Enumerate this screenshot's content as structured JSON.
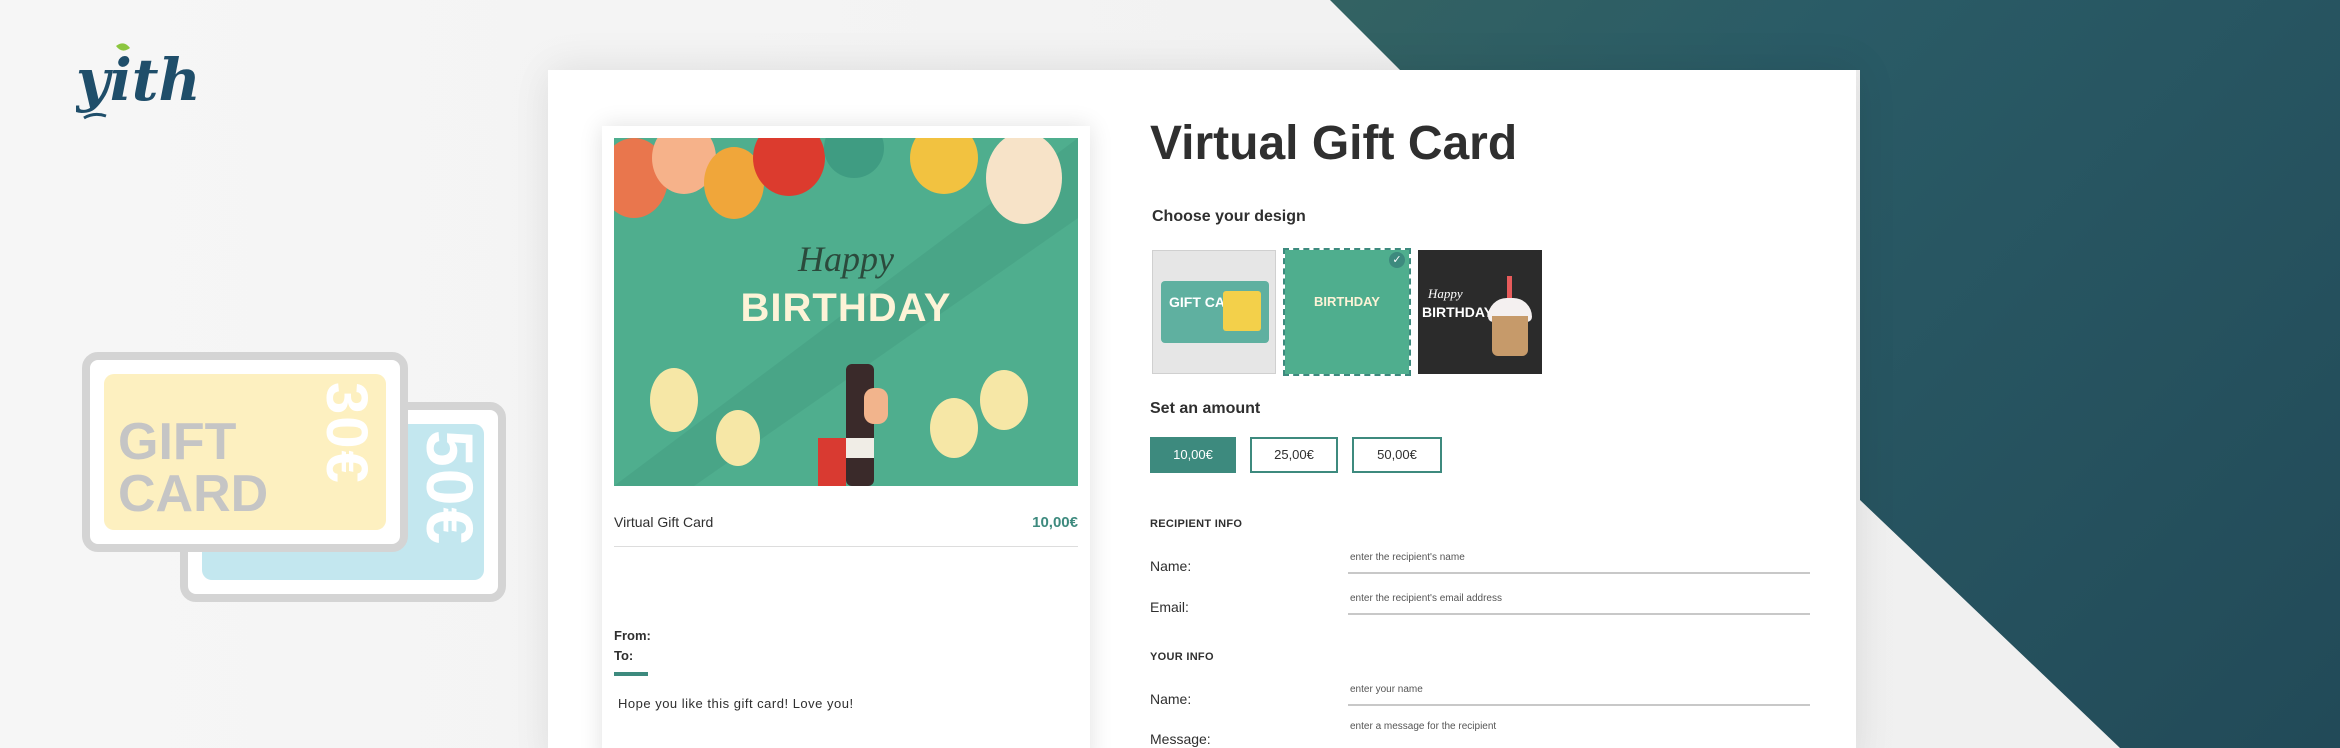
{
  "brand": {
    "logo_text": "yith"
  },
  "gift_card_icon": {
    "front_text": "GIFT\nCARD",
    "front_value": "30€",
    "back_value": "50€"
  },
  "preview": {
    "image_happy": "Happy",
    "image_birthday": "BIRTHDAY",
    "product_title": "Virtual Gift Card",
    "price": "10,00€",
    "from_label": "From:",
    "to_label": "To:",
    "message": "Hope you like this gift card! Love you!"
  },
  "form": {
    "title": "Virtual Gift Card",
    "choose_design_label": "Choose your design",
    "designs": [
      {
        "name": "gift-card-design",
        "text": "GIFT CARD",
        "selected": false
      },
      {
        "name": "birthday-design",
        "text": "BIRTHDAY",
        "selected": true
      },
      {
        "name": "chalkboard-birthday-design",
        "text1": "Happy",
        "text2": "BIRTHDAY",
        "selected": false
      }
    ],
    "amount_label": "Set an amount",
    "amounts": [
      "10,00€",
      "25,00€",
      "50,00€"
    ],
    "selected_amount": "10,00€",
    "recipient_section": "RECIPIENT INFO",
    "recipient_name_label": "Name:",
    "recipient_name_placeholder": "enter the recipient's name",
    "recipient_email_label": "Email:",
    "recipient_email_placeholder": "enter the recipient's email address",
    "your_info_section": "YOUR INFO",
    "your_name_label": "Name:",
    "your_name_placeholder": "enter your name",
    "message_label": "Message:",
    "message_placeholder": "enter a message for the recipient"
  },
  "colors": {
    "accent": "#3d8a7e",
    "card_green": "#4fae8e"
  }
}
